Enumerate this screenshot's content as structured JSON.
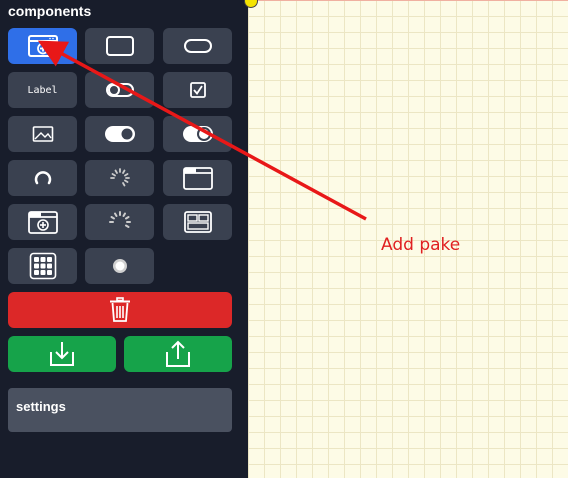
{
  "sidebar": {
    "title": "components",
    "tiles": [
      {
        "icon": "add-window-icon",
        "active": true
      },
      {
        "icon": "rectangle-icon"
      },
      {
        "icon": "rounded-pill-icon"
      },
      {
        "icon": "label-text-icon",
        "label": "Label"
      },
      {
        "icon": "toggle-off-icon"
      },
      {
        "icon": "checkbox-icon"
      },
      {
        "icon": "image-icon"
      },
      {
        "icon": "toggle-on-icon"
      },
      {
        "icon": "toggle-switch-icon"
      },
      {
        "icon": "spinner-arc-icon"
      },
      {
        "icon": "spinner-dots-icon"
      },
      {
        "icon": "folder-tab-icon"
      },
      {
        "icon": "add-folder-icon"
      },
      {
        "icon": "spinner-dots-large-icon"
      },
      {
        "icon": "layout-panels-icon"
      },
      {
        "icon": "grid-icon"
      },
      {
        "icon": "radio-dot-icon"
      }
    ],
    "delete_icon": "trash-icon",
    "import_icon": "download-tray-icon",
    "export_icon": "share-upload-icon",
    "settings_title": "settings"
  },
  "annotation": {
    "text": "Add pake",
    "color": "#e02020"
  },
  "colors": {
    "sidebar_bg": "#181d2b",
    "tile_bg": "#3a4150",
    "active_tile": "#2f6fe8",
    "delete": "#dc2828",
    "io": "#16a34a",
    "canvas_bg": "#fdfbe6"
  }
}
